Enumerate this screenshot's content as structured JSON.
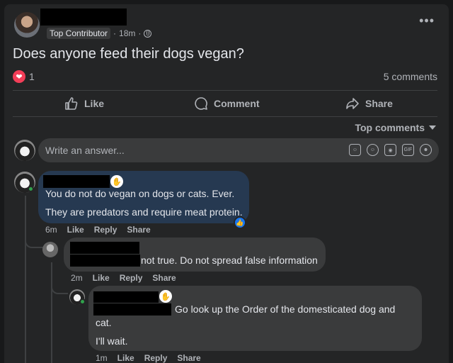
{
  "post": {
    "badge": "Top Contributor",
    "time": "18m",
    "title": "Does anyone feed their dogs vegan?",
    "reaction_count": "1",
    "comments_count": "5 comments",
    "more_label": "•••"
  },
  "actions": {
    "like": "Like",
    "comment": "Comment",
    "share": "Share"
  },
  "sort": {
    "label": "Top comments"
  },
  "composer": {
    "placeholder": "Write an answer..."
  },
  "comments": [
    {
      "lines": [
        "You do not do vegan on dogs or cats. Ever.",
        "They are predators and require meat protein."
      ],
      "time": "6m",
      "like": "Like",
      "reply": "Reply",
      "share": "Share"
    },
    {
      "lines": [
        "not true. Do not spread false information"
      ],
      "time": "2m",
      "like": "Like",
      "reply": "Reply",
      "share": "Share"
    },
    {
      "lines": [
        "Go look up the Order of the domesticated dog and",
        "cat.",
        "I'll wait."
      ],
      "time": "1m",
      "like": "Like",
      "reply": "Reply",
      "share": "Share"
    }
  ],
  "colors": {
    "background": "#18191a",
    "card": "#242526",
    "bubble_highlight": "#263951",
    "bubble": "#3a3b3c",
    "heart": "#f33e58",
    "like_blue": "#1877f2",
    "online": "#31a24c"
  },
  "icons": {
    "heart": "heart-icon",
    "like": "thumbs-up-icon",
    "comment": "speech-bubble-icon",
    "share": "share-arrow-icon",
    "globe": "globe-icon"
  }
}
